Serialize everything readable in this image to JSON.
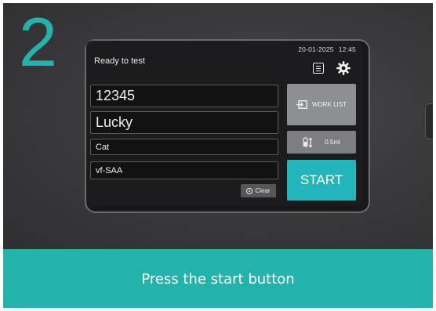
{
  "step_number": "2",
  "screen": {
    "status": "Ready to test",
    "date": "20-01-2025",
    "time": "12:45",
    "icons": {
      "worklist_view": "list-icon",
      "settings": "gear-icon"
    },
    "fields": {
      "sample_id": "12345",
      "patient_name": "Lucky",
      "species": "Cat",
      "test": "vf-SAA"
    },
    "clear_label": "Clear",
    "worklist_label": "WORK LIST",
    "volume_label": "0.5ml",
    "start_label": "START"
  },
  "caption": "Press the start button",
  "colors": {
    "accent": "#22b3aa",
    "start_button": "#22b5b9",
    "worklist_button": "#8e8f92",
    "background": "#3b3b3d"
  }
}
